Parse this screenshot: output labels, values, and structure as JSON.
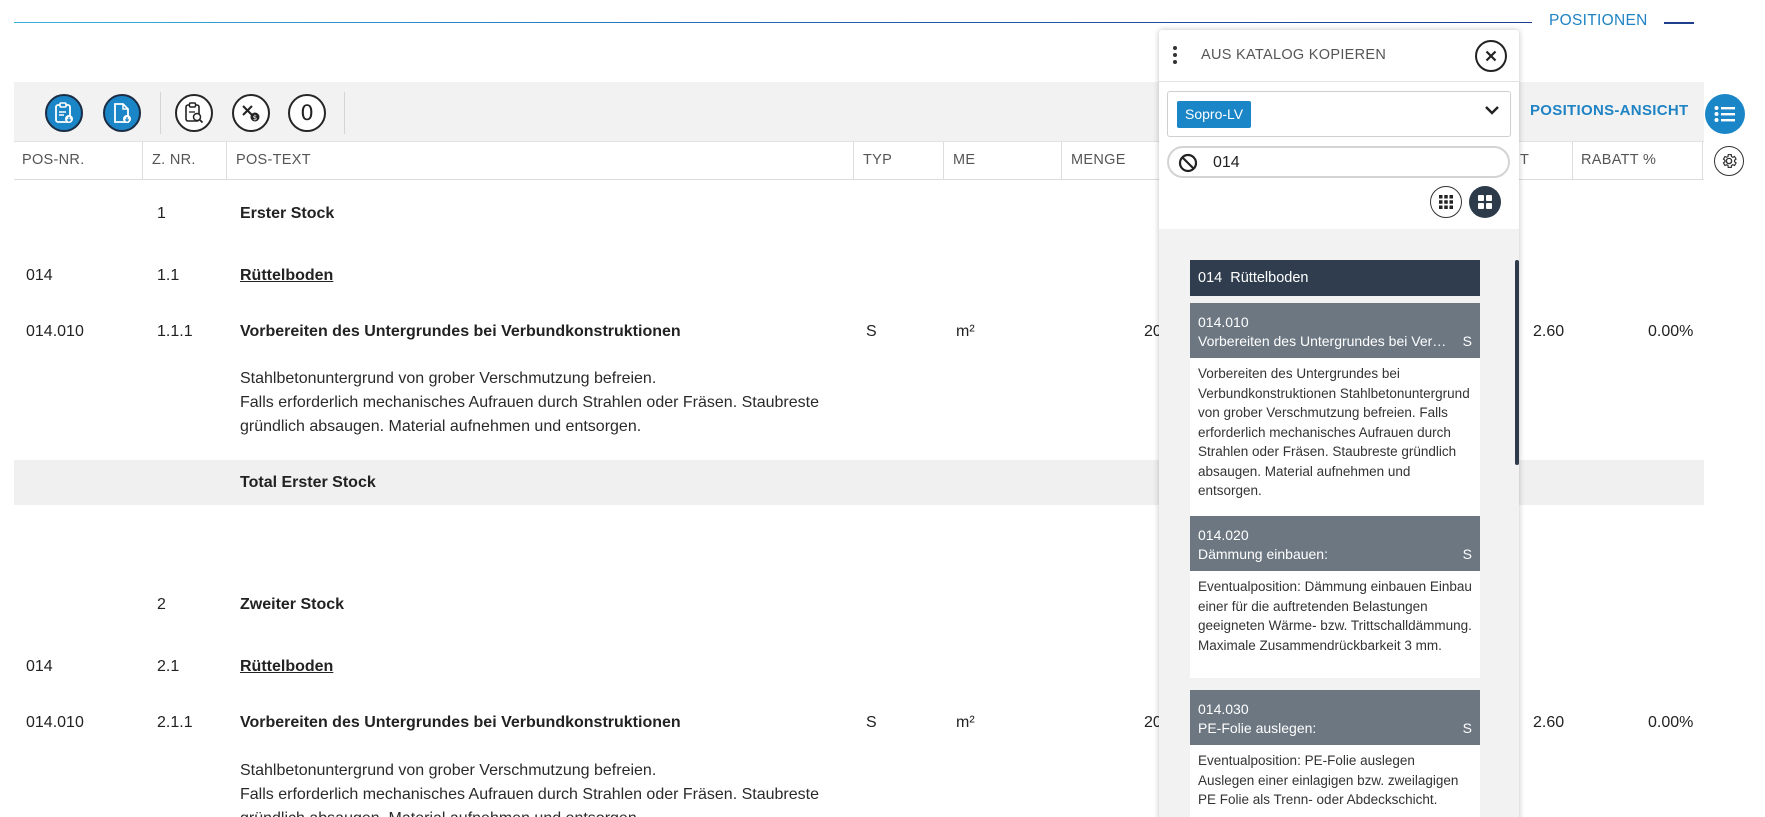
{
  "header": {
    "title": "POSITIONEN"
  },
  "toolbar": {
    "zero_label": "0",
    "view_label": "POSITIONS-ANSICHT"
  },
  "table": {
    "columns": [
      "POS-NR.",
      "Z. NR.",
      "POS-TEXT",
      "TYP",
      "ME",
      "MENGE",
      "T",
      "RABATT %"
    ],
    "rows": [
      {
        "znr": "1",
        "text": "Erster Stock"
      },
      {
        "pos": "014",
        "znr": "1.1",
        "text": "Rüttelboden"
      },
      {
        "pos": "014.010",
        "znr": "1.1.1",
        "text": "Vorbereiten des Untergrundes bei Verbundkonstruktionen",
        "typ": "S",
        "me": "m²",
        "menge": "20",
        "price": "2.60",
        "rabatt": "0.00%",
        "desc": [
          "Stahlbetonuntergrund von grober Verschmutzung befreien.",
          "Falls erforderlich mechanisches Aufrauen durch Strahlen oder Fräsen. Staubreste",
          "gründlich absaugen. Material aufnehmen und entsorgen."
        ]
      },
      {
        "text": "Total Erster Stock"
      },
      {
        "znr": "2",
        "text": "Zweiter Stock"
      },
      {
        "pos": "014",
        "znr": "2.1",
        "text": "Rüttelboden"
      },
      {
        "pos": "014.010",
        "znr": "2.1.1",
        "text": "Vorbereiten des Untergrundes bei Verbundkonstruktionen",
        "typ": "S",
        "me": "m²",
        "menge": "20",
        "price": "2.60",
        "rabatt": "0.00%",
        "desc": [
          "Stahlbetonuntergrund von grober Verschmutzung befreien.",
          "Falls erforderlich mechanisches Aufrauen durch Strahlen oder Fräsen. Staubreste",
          "gründlich absaugen. Material aufnehmen und entsorgen."
        ]
      }
    ]
  },
  "panel": {
    "title": "AUS KATALOG KOPIEREN",
    "catalog_chip": "Sopro-LV",
    "search_value": "014",
    "group": {
      "code": "014",
      "name": "Rüttelboden"
    },
    "items": [
      {
        "code": "014.010",
        "title": "Vorbereiten des Untergrundes bei Verbun...",
        "type": "S",
        "body": "Vorbereiten des Untergrundes bei Verbundkonstruktionen Stahlbetonuntergrund von grober Verschmutzung befreien. Falls erforderlich mechanisches Aufrauen durch Strahlen oder Fräsen. Staubreste gründlich absaugen. Material aufnehmen und entsorgen."
      },
      {
        "code": "014.020",
        "title": "Dämmung einbauen:",
        "type": "S",
        "body": "Eventualposition: Dämmung einbauen Einbau einer für die auftretenden Belastungen geeigneten Wärme- bzw. Trittschalldämmung. Maximale Zusammendrückbarkeit 3 mm."
      },
      {
        "code": "014.030",
        "title": "PE-Folie auslegen:",
        "type": "S",
        "body": "Eventualposition: PE-Folie auslegen Auslegen einer einlagigen bzw. zweilagigen PE Folie als Trenn- oder Abdeckschicht."
      }
    ]
  },
  "colors": {
    "accent": "#1a85c7",
    "dark": "#2f3d4e",
    "item_head": "#6c7782"
  }
}
